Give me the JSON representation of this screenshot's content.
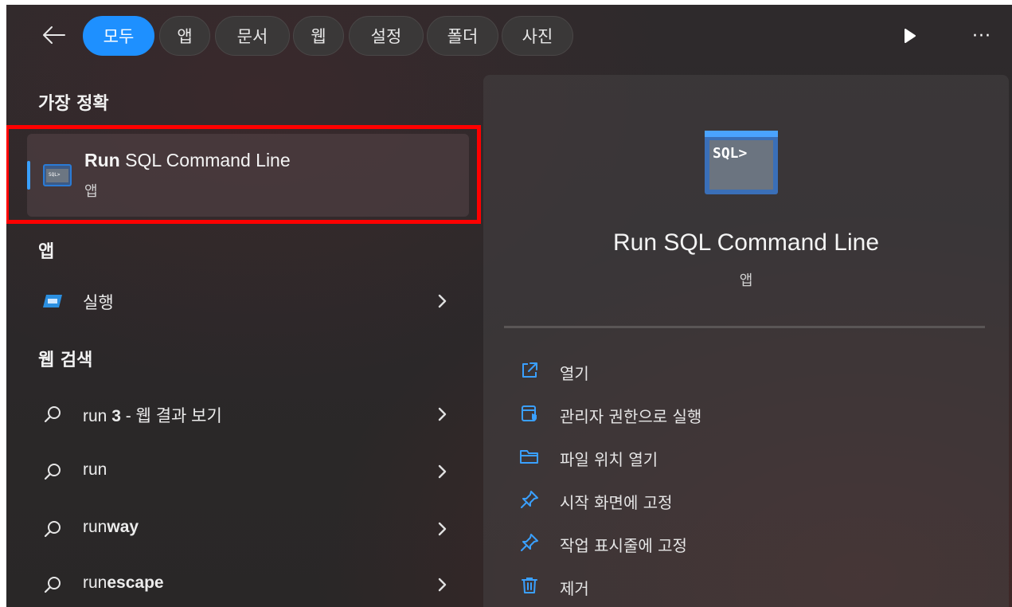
{
  "filters": {
    "tabs": [
      {
        "label": "모두",
        "active": true
      },
      {
        "label": "앱",
        "active": false
      },
      {
        "label": "문서",
        "active": false
      },
      {
        "label": "웹",
        "active": false
      },
      {
        "label": "설정",
        "active": false
      },
      {
        "label": "폴더",
        "active": false
      },
      {
        "label": "사진",
        "active": false
      }
    ],
    "more_label": "···"
  },
  "best_match": {
    "section_title": "가장 정확",
    "title_bold": "Run",
    "title_rest": " SQL Command Line",
    "subtitle": "앱",
    "icon": "sql-terminal-icon"
  },
  "apps": {
    "section_title": "앱",
    "items": [
      {
        "label": "실행",
        "icon": "run-dialog-icon"
      }
    ]
  },
  "web": {
    "section_title": "웹 검색",
    "items": [
      {
        "prefix": "run ",
        "bold": "3",
        "suffix": " - 웹 결과 보기"
      },
      {
        "prefix": "run",
        "bold": "",
        "suffix": ""
      },
      {
        "prefix": "run",
        "bold": "way",
        "suffix": ""
      },
      {
        "prefix": "run",
        "bold": "escape",
        "suffix": ""
      }
    ]
  },
  "detail": {
    "title": "Run SQL Command Line",
    "subtitle": "앱",
    "icon_text": "SQL>",
    "actions": [
      {
        "label": "열기",
        "icon": "open-external-icon"
      },
      {
        "label": "관리자 권한으로 실행",
        "icon": "admin-shield-icon"
      },
      {
        "label": "파일 위치 열기",
        "icon": "folder-icon"
      },
      {
        "label": "시작 화면에 고정",
        "icon": "pin-icon"
      },
      {
        "label": "작업 표시줄에 고정",
        "icon": "pin-icon"
      },
      {
        "label": "제거",
        "icon": "trash-icon"
      }
    ]
  },
  "colors": {
    "accent": "#1e90ff",
    "highlight_box": "#ff0000",
    "icon_blue": "#3aa0ff"
  }
}
